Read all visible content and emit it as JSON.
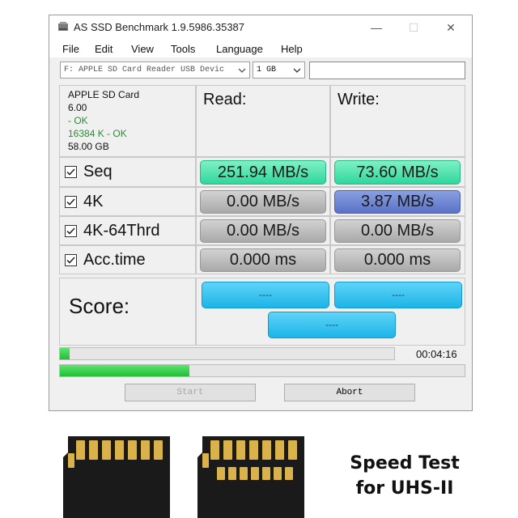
{
  "window": {
    "title": "AS SSD Benchmark 1.9.5986.35387",
    "menus": [
      "File",
      "Edit",
      "View",
      "Tools",
      "Language",
      "Help"
    ],
    "drive_select": "F: APPLE SD Card Reader USB Devic",
    "size_select": "1 GB",
    "search_value": ""
  },
  "device": {
    "name": "APPLE SD Card",
    "version": "6.00",
    "status1": " - OK",
    "status2": "16384 K - OK",
    "capacity": "58.00 GB"
  },
  "headers": {
    "read": "Read:",
    "write": "Write:"
  },
  "rows": [
    {
      "label": "Seq",
      "read": "251.94 MB/s",
      "write": "73.60 MB/s",
      "read_color": "green",
      "write_color": "green"
    },
    {
      "label": "4K",
      "read": "0.00 MB/s",
      "write": "3.87 MB/s",
      "read_color": "gray",
      "write_color": "blue"
    },
    {
      "label": "4K-64Thrd",
      "read": "0.00 MB/s",
      "write": "0.00 MB/s",
      "read_color": "gray",
      "write_color": "gray"
    },
    {
      "label": "Acc.time",
      "read": "0.000 ms",
      "write": "0.000 ms",
      "read_color": "gray",
      "write_color": "gray"
    }
  ],
  "score": {
    "label": "Score:",
    "read": "----",
    "write": "----",
    "total": "----"
  },
  "progress": {
    "elapsed": "00:04:16",
    "bar1_fraction": 0.03,
    "bar2_fraction": 0.32
  },
  "buttons": {
    "start": "Start",
    "abort": "Abort"
  },
  "promo": {
    "line1": "Speed Test",
    "line2": "for UHS-II"
  },
  "colors": {
    "green": "#30d79d",
    "gray": "#a9a9a9",
    "blue": "#5a72c8",
    "cyan": "#1cb5e8"
  }
}
